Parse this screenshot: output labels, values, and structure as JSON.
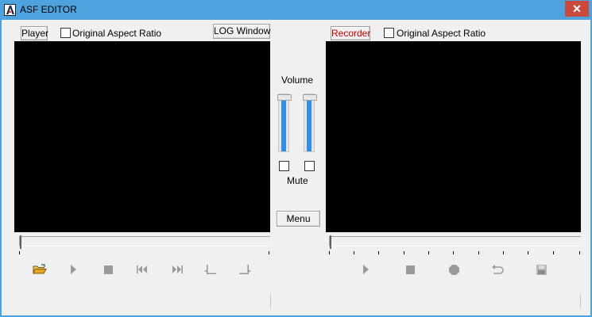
{
  "window": {
    "title": "ASF EDITOR",
    "close_glyph": "✕"
  },
  "player": {
    "button_label": "Player",
    "aspect_label": "Original Aspect Ratio",
    "aspect_checked": false,
    "log_button_label": "LOG Window",
    "seek_position": 0
  },
  "recorder": {
    "button_label": "Recorder",
    "aspect_label": "Original Aspect Ratio",
    "aspect_checked": false,
    "seek_position": 0
  },
  "mixer": {
    "volume_label": "Volume",
    "mute_label": "Mute",
    "menu_button_label": "Menu",
    "volumes": [
      1.0,
      1.0
    ],
    "mute_checked": [
      false,
      false
    ]
  },
  "player_controls": [
    {
      "name": "open-folder-icon"
    },
    {
      "name": "play-icon"
    },
    {
      "name": "stop-icon"
    },
    {
      "name": "skip-back-icon"
    },
    {
      "name": "skip-forward-icon"
    },
    {
      "name": "mark-in-icon"
    },
    {
      "name": "mark-out-icon"
    }
  ],
  "recorder_controls": [
    {
      "name": "play-icon"
    },
    {
      "name": "stop-icon"
    },
    {
      "name": "record-icon"
    },
    {
      "name": "undo-icon"
    },
    {
      "name": "save-icon"
    }
  ],
  "colors": {
    "titlebar": "#4ea3df",
    "close_button": "#c94a3c",
    "recorder_text": "#c00000",
    "volume_fill": "#2f8ee8",
    "disabled_icon": "#9a9a9a"
  }
}
